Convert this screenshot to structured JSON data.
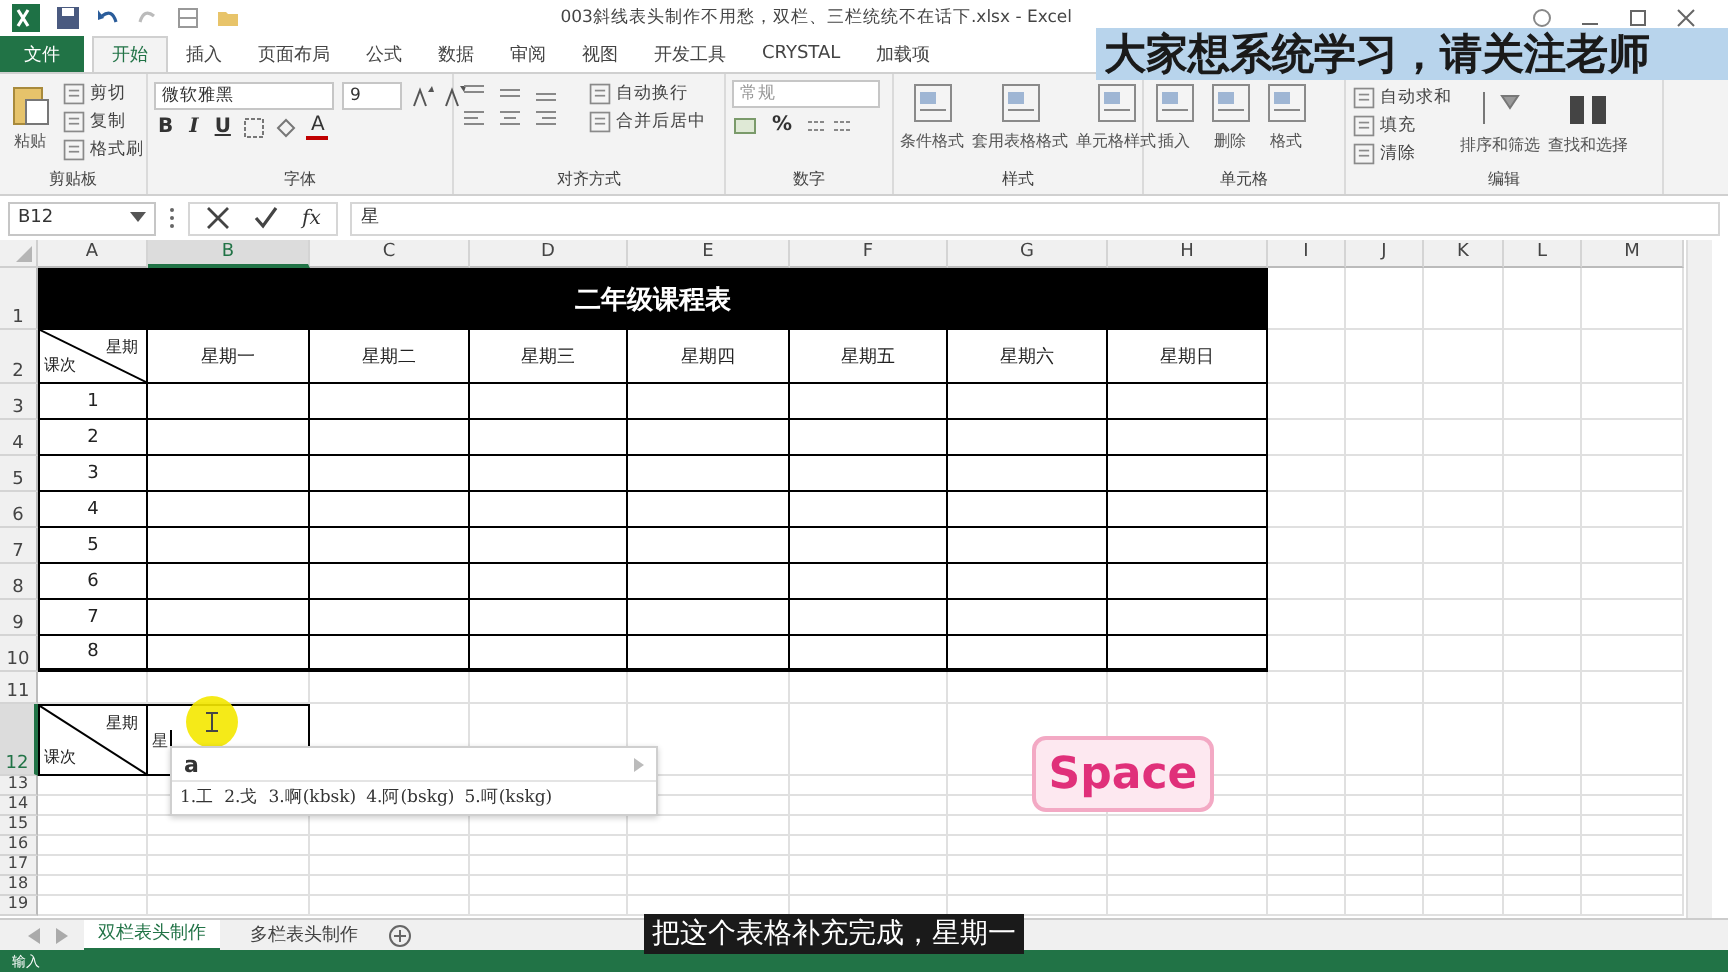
{
  "window": {
    "title": "003斜线表头制作不用愁，双栏、三栏统统不在话下.xlsx - Excel"
  },
  "ribbon_tabs": [
    {
      "label": "文件",
      "kind": "file",
      "selected": false
    },
    {
      "label": "开始",
      "kind": "tab",
      "selected": true
    },
    {
      "label": "插入",
      "kind": "tab",
      "selected": false
    },
    {
      "label": "页面布局",
      "kind": "tab",
      "selected": false
    },
    {
      "label": "公式",
      "kind": "tab",
      "selected": false
    },
    {
      "label": "数据",
      "kind": "tab",
      "selected": false
    },
    {
      "label": "审阅",
      "kind": "tab",
      "selected": false
    },
    {
      "label": "视图",
      "kind": "tab",
      "selected": false
    },
    {
      "label": "开发工具",
      "kind": "tab",
      "selected": false
    },
    {
      "label": "CRYSTAL",
      "kind": "tab",
      "selected": false
    },
    {
      "label": "加载项",
      "kind": "tab",
      "selected": false
    }
  ],
  "ribbon_groups": [
    {
      "kind": "clipboard",
      "label": "剪贴板",
      "paste": "粘贴",
      "items": [
        "剪切",
        "复制",
        "格式刷"
      ]
    },
    {
      "kind": "font",
      "label": "字体",
      "font_name": "微软雅黑",
      "font_size": "9",
      "styles": [
        "B",
        "I",
        "U"
      ],
      "font_color": "A"
    },
    {
      "kind": "alignment",
      "label": "对齐方式",
      "items": [
        "自动换行",
        "合并后居中"
      ]
    },
    {
      "kind": "number",
      "label": "数字",
      "format": "常规",
      "percent": "%"
    },
    {
      "kind": "large",
      "label": "样式",
      "items": [
        "条件格式",
        "套用表格格式",
        "单元格样式"
      ]
    },
    {
      "kind": "large",
      "label": "单元格",
      "items": [
        "插入",
        "删除",
        "格式"
      ]
    },
    {
      "kind": "editing",
      "label": "编辑",
      "items": [
        "自动求和",
        "填充",
        "清除"
      ],
      "large_items": [
        "排序和筛选",
        "查找和选择"
      ]
    }
  ],
  "formula_bar": {
    "name_box": "B12",
    "function_label": "fx",
    "formula": "星"
  },
  "columns": [
    {
      "label": "A",
      "selected": false
    },
    {
      "label": "B",
      "selected": true
    },
    {
      "label": "C",
      "selected": false
    },
    {
      "label": "D",
      "selected": false
    },
    {
      "label": "E",
      "selected": false
    },
    {
      "label": "F",
      "selected": false
    },
    {
      "label": "G",
      "selected": false
    },
    {
      "label": "H",
      "selected": false
    },
    {
      "label": "I",
      "selected": false
    },
    {
      "label": "J",
      "selected": false
    },
    {
      "label": "K",
      "selected": false
    },
    {
      "label": "L",
      "selected": false
    },
    {
      "label": "M",
      "selected": false
    }
  ],
  "rows": [
    {
      "label": "1",
      "selected": false
    },
    {
      "label": "2",
      "selected": false
    },
    {
      "label": "3",
      "selected": false
    },
    {
      "label": "4",
      "selected": false
    },
    {
      "label": "5",
      "selected": false
    },
    {
      "label": "6",
      "selected": false
    },
    {
      "label": "7",
      "selected": false
    },
    {
      "label": "8",
      "selected": false
    },
    {
      "label": "9",
      "selected": false
    },
    {
      "label": "10",
      "selected": false
    },
    {
      "label": "11",
      "selected": false
    },
    {
      "label": "12",
      "selected": true
    },
    {
      "label": "13",
      "selected": false
    },
    {
      "label": "14",
      "selected": false
    },
    {
      "label": "15",
      "selected": false
    },
    {
      "label": "16",
      "selected": false
    },
    {
      "label": "17",
      "selected": false
    },
    {
      "label": "18",
      "selected": false
    },
    {
      "label": "19",
      "selected": false
    }
  ],
  "timetable": {
    "title": "二年级课程表",
    "corner": {
      "top": "星期",
      "bottom": "课次"
    },
    "days": [
      "星期一",
      "星期二",
      "星期三",
      "星期四",
      "星期五",
      "星期六",
      "星期日"
    ],
    "periods": [
      "1",
      "2",
      "3",
      "4",
      "5",
      "6",
      "7",
      "8"
    ]
  },
  "draft_table": {
    "corner": {
      "top": "星期",
      "bottom": "课次"
    },
    "editing_text": "星"
  },
  "ime_popup": {
    "input": "a",
    "candidates": [
      "1.工",
      "2.戈",
      "3.啊(kbsk)",
      "4.阿(bskg)",
      "5.呵(kskg)"
    ]
  },
  "key_overlay": "Space",
  "banner": "大家想系统学习，请关注老师",
  "subtitle": "把这个表格补充完成，星期一",
  "sheet_tabs": [
    {
      "label": "双栏表头制作",
      "selected": true
    },
    {
      "label": "多栏表头制作",
      "selected": false
    }
  ],
  "status_bar": {
    "mode": "输入"
  }
}
